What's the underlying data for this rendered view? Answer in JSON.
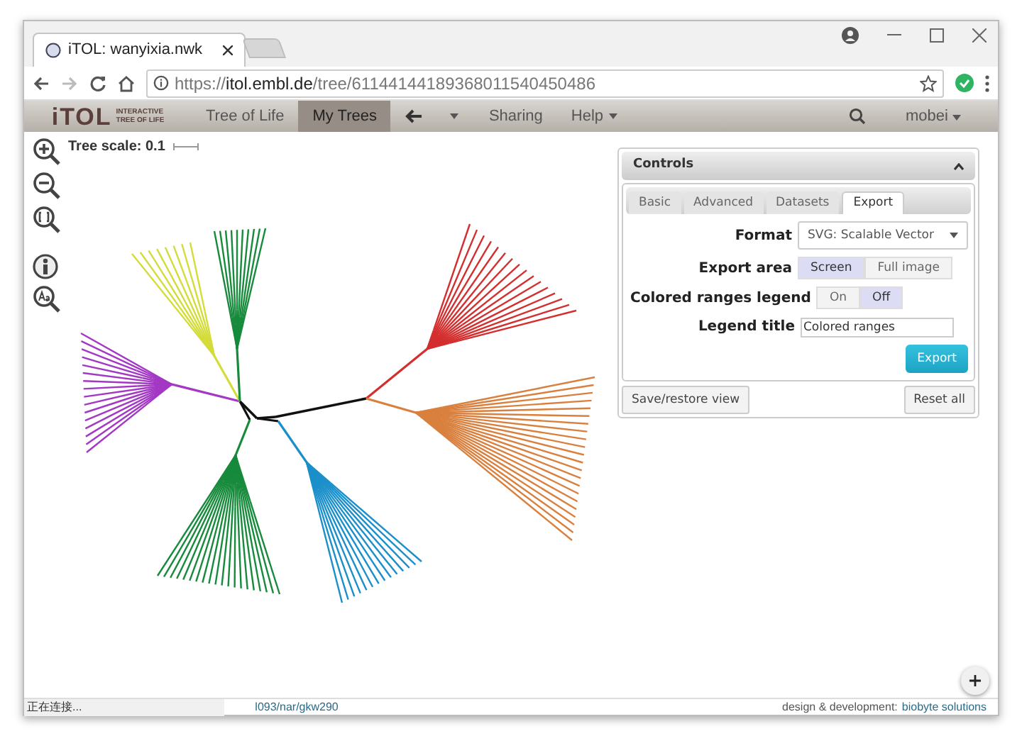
{
  "browser": {
    "tabs": [
      {
        "title": "iTOL: wanyixia.nwk",
        "selected": true
      }
    ],
    "url": {
      "scheme": "https://",
      "host": "itol.embl.de",
      "path": "/tree/61144144189368011540450486"
    }
  },
  "navbar": {
    "logo": "iTOL",
    "logo_sub": [
      "INTERACTIVE",
      "TREE OF LIFE"
    ],
    "items": [
      {
        "kind": "link",
        "label": "Tree of Life",
        "selected": false
      },
      {
        "kind": "link",
        "label": "My Trees",
        "selected": true
      },
      {
        "kind": "back",
        "selected": false
      },
      {
        "kind": "caret",
        "selected": false
      },
      {
        "kind": "link",
        "label": "Sharing",
        "selected": false
      },
      {
        "kind": "menu",
        "label": "Help",
        "selected": false
      }
    ],
    "user": "mobei"
  },
  "tree_scale": "Tree scale: 0.1",
  "controls": {
    "title": "Controls",
    "tabs": [
      {
        "label": "Basic",
        "selected": false
      },
      {
        "label": "Advanced",
        "selected": false
      },
      {
        "label": "Datasets",
        "selected": false
      },
      {
        "label": "Export",
        "selected": true
      }
    ],
    "format": {
      "label": "Format",
      "value": "SVG: Scalable Vector"
    },
    "export_area": {
      "label": "Export area",
      "options": [
        {
          "label": "Screen",
          "selected": true
        },
        {
          "label": "Full image",
          "selected": false
        }
      ]
    },
    "legend": {
      "label": "Colored ranges legend",
      "options": [
        {
          "label": "On",
          "selected": false
        },
        {
          "label": "Off",
          "selected": true
        }
      ]
    },
    "legend_title": {
      "label": "Legend title",
      "value": "Colored ranges"
    },
    "export_button": "Export",
    "save_button": "Save/restore view",
    "reset_button": "Reset all"
  },
  "status_bar": {
    "status": "正在连接...",
    "link": "l093/nar/gkw290",
    "credit": "design & development:",
    "credit_link": "biobyte solutions"
  }
}
